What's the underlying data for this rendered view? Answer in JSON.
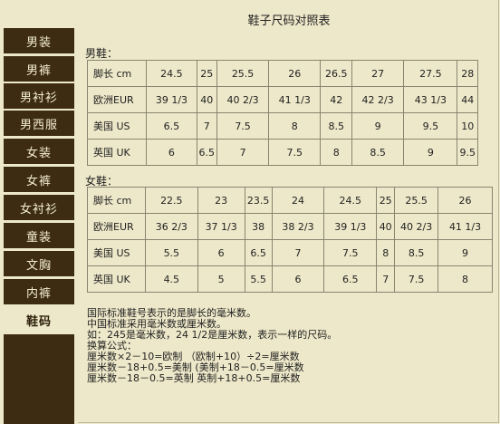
{
  "sidebar": {
    "items": [
      {
        "label": "男装"
      },
      {
        "label": "男裤"
      },
      {
        "label": "男衬衫"
      },
      {
        "label": "男西服"
      },
      {
        "label": "女装"
      },
      {
        "label": "女裤"
      },
      {
        "label": "女衬衫"
      },
      {
        "label": "童装"
      },
      {
        "label": "文胸"
      },
      {
        "label": "内裤"
      },
      {
        "label": "鞋码"
      }
    ],
    "active_index": 10
  },
  "page": {
    "title": "鞋子尺码对照表"
  },
  "men": {
    "label": "男鞋：",
    "rows": [
      [
        "脚长 cm",
        "24.5",
        "25",
        "25.5",
        "26",
        "26.5",
        "27",
        "27.5",
        "28"
      ],
      [
        "欧洲EUR",
        "39 1/3",
        "40",
        "40 2/3",
        "41 1/3",
        "42",
        "42 2/3",
        "43 1/3",
        "44"
      ],
      [
        "美国 US",
        "6.5",
        "7",
        "7.5",
        "8",
        "8.5",
        "9",
        "9.5",
        "10"
      ],
      [
        "英国 UK",
        "6",
        "6.5",
        "7",
        "7.5",
        "8",
        "8.5",
        "9",
        "9.5"
      ]
    ]
  },
  "women": {
    "label": "女鞋：",
    "rows": [
      [
        "脚长 cm",
        "22.5",
        "23",
        "23.5",
        "24",
        "24.5",
        "25",
        "25.5",
        "26"
      ],
      [
        "欧洲EUR",
        "36 2/3",
        "37 1/3",
        "38",
        "38 2/3",
        "39 1/3",
        "40",
        "40 2/3",
        "41 1/3"
      ],
      [
        "美国 US",
        "5.5",
        "6",
        "6.5",
        "7",
        "7.5",
        "8",
        "8.5",
        "9"
      ],
      [
        "英国 UK",
        "4.5",
        "5",
        "5.5",
        "6",
        "6.5",
        "7",
        "7.5",
        "8"
      ]
    ]
  },
  "notes": [
    "国际标准鞋号表示的是脚长的毫米数。",
    "中国标准采用毫米数或厘米数。",
    "如：245是毫米数，24 1/2是厘米数，表示一样的尺码。",
    "换算公式：",
    "厘米数×2－10=欧制 （欧制+10）÷2=厘米数",
    "厘米数－18+0.5=美制 (美制+18－0.5=厘米数",
    "厘米数－18－0.5=英制 英制+18+0.5=厘米数"
  ]
}
